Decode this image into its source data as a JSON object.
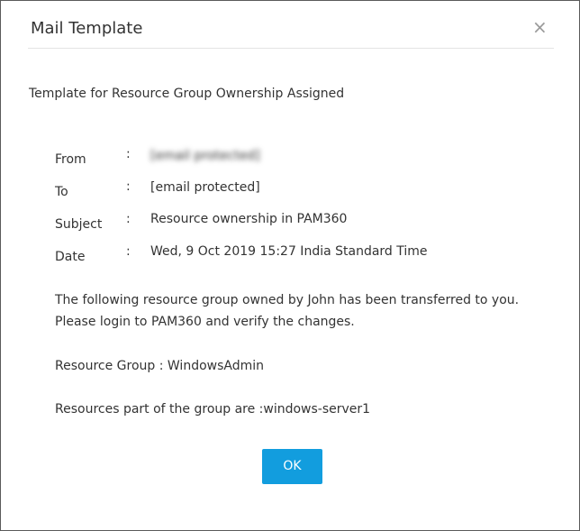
{
  "dialog": {
    "title": "Mail Template",
    "close_glyph": "×",
    "close_icon": "close-icon"
  },
  "template_title": "Template for Resource Group Ownership Assigned",
  "fields": [
    {
      "label": "From",
      "colon": ":",
      "value": "[email protected]"
    },
    {
      "label": "To",
      "colon": ":",
      "value": "[email protected]"
    },
    {
      "label": "Subject",
      "colon": ":",
      "value": "Resource ownership in PAM360"
    },
    {
      "label": "Date",
      "colon": ":",
      "value": "Wed, 9 Oct 2019 15:27 India Standard Time"
    }
  ],
  "body": {
    "line1": "The following resource group owned by John has been transferred to you.",
    "line2": "Please login to PAM360 and verify the changes.",
    "resource_group": "Resource Group : WindowsAdmin",
    "resources": "Resources part of the group are :windows-server1"
  },
  "actions": {
    "ok_label": "OK"
  },
  "colors": {
    "ok_button": "#129dde",
    "border": "#5a5a5a",
    "divider": "#e3e3e3"
  }
}
